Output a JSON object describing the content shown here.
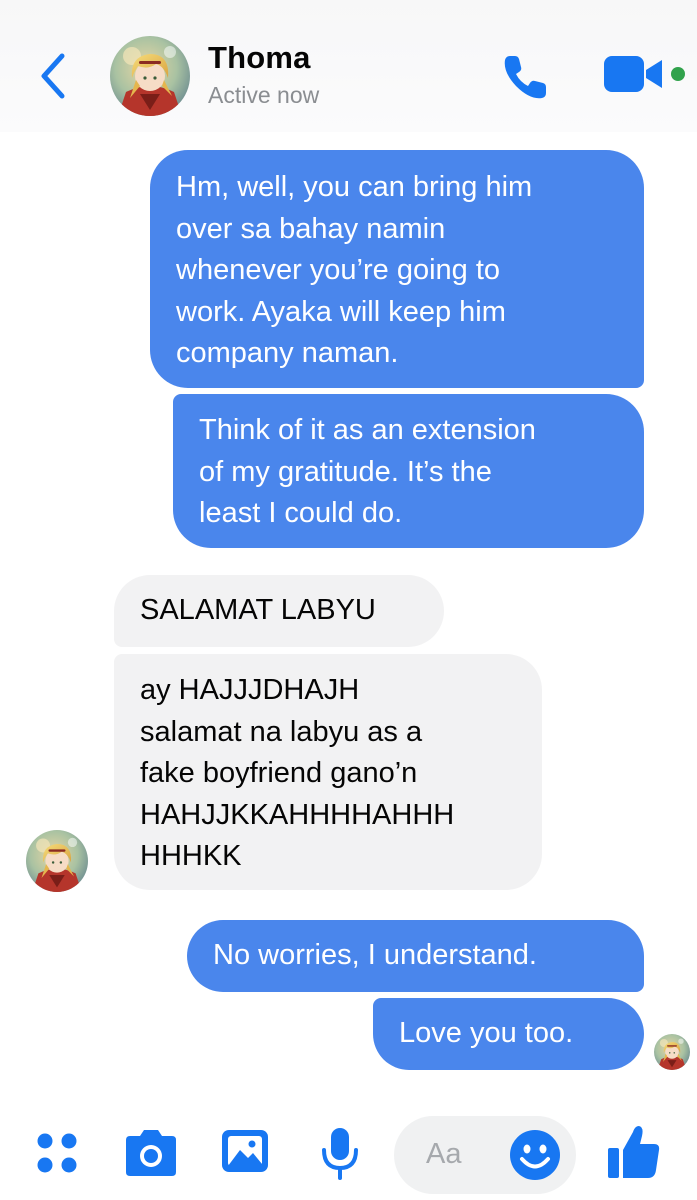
{
  "header": {
    "contact_name": "Thoma",
    "status": "Active now"
  },
  "messages": [
    {
      "direction": "outgoing",
      "lines": [
        "Hm, well, you can bring him",
        "over sa bahay namin",
        "whenever you’re going to",
        "work. Ayaka will keep him",
        "company naman."
      ]
    },
    {
      "direction": "outgoing",
      "lines": [
        "Think of it as an extension",
        "of my gratitude. It’s the",
        "least I could do."
      ]
    },
    {
      "direction": "incoming",
      "lines": [
        "SALAMAT LABYU"
      ]
    },
    {
      "direction": "incoming",
      "lines": [
        "ay HAJJJDHAJH",
        "salamat na labyu as a",
        "fake boyfriend gano’n",
        "HAHJJKKAHHHHAHHH",
        "HHHKK"
      ]
    },
    {
      "direction": "outgoing",
      "lines": [
        "No worries, I understand."
      ]
    },
    {
      "direction": "outgoing",
      "lines": [
        "Love you too."
      ]
    }
  ],
  "composer": {
    "placeholder": "Aa"
  },
  "icons": {
    "back": "chevron-left-icon",
    "call": "phone-icon",
    "video": "video-camera-icon",
    "menu": "four-dots-icon",
    "camera": "camera-icon",
    "gallery": "photo-icon",
    "voice": "microphone-icon",
    "emoji": "smiley-icon",
    "like": "thumbs-up-icon"
  },
  "colors": {
    "accent": "#1877f2",
    "outgoing_bubble": "#4a86ec",
    "incoming_bubble": "#f2f2f3",
    "online_dot": "#31a24c"
  }
}
